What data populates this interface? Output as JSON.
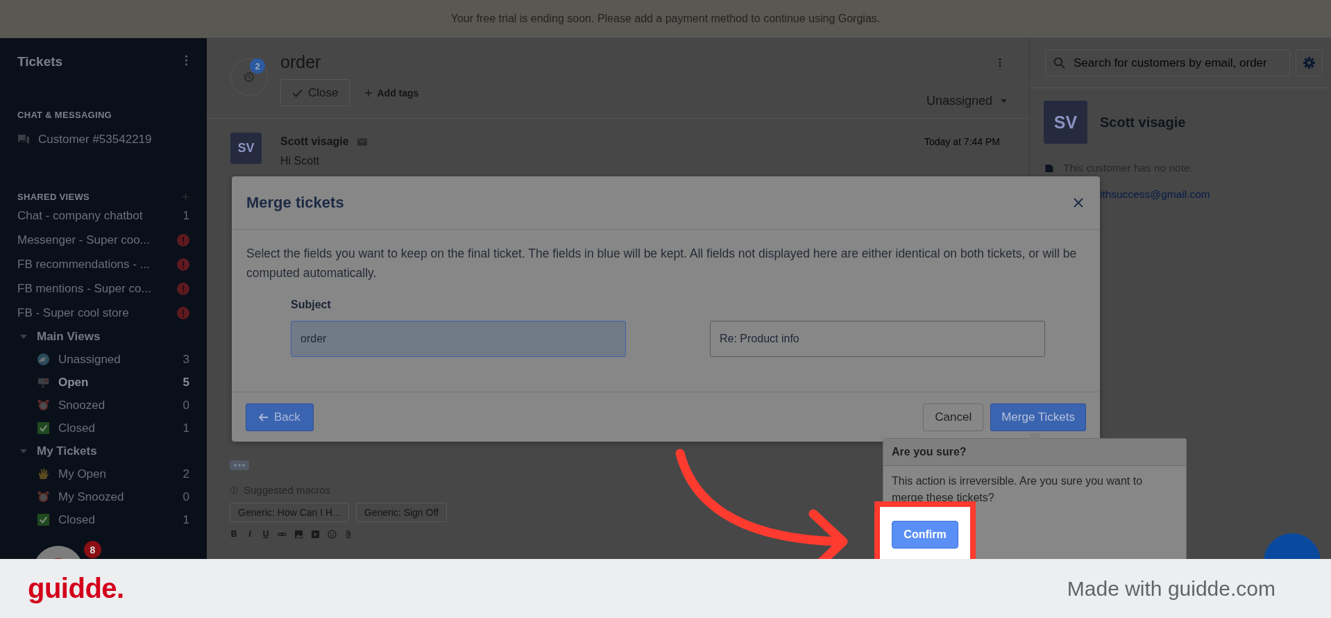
{
  "banner": {
    "text": "Your free trial is ending soon. Please add a payment method to continue using Gorgias."
  },
  "sidebar": {
    "title": "Tickets",
    "chat_section": {
      "heading": "CHAT & MESSAGING",
      "items": [
        {
          "label": "Customer #53542219"
        }
      ]
    },
    "shared_views": {
      "heading": "SHARED VIEWS",
      "items": [
        {
          "label": "Chat - company chatbot",
          "kind": "count",
          "count": "1"
        },
        {
          "label": "Messenger - Super coo...",
          "kind": "alert"
        },
        {
          "label": "FB recommendations - ...",
          "kind": "alert"
        },
        {
          "label": "FB mentions - Super co...",
          "kind": "alert"
        },
        {
          "label": "FB - Super cool store",
          "kind": "alert"
        }
      ]
    },
    "groups": [
      {
        "title": "Main Views",
        "expanded": true,
        "children": [
          {
            "label": "Unassigned",
            "kind": "wave",
            "count": "3",
            "selected": false
          },
          {
            "label": "Open",
            "kind": "mailbox",
            "count": "5",
            "selected": true
          },
          {
            "label": "Snoozed",
            "kind": "alarm",
            "count": "0",
            "selected": false
          },
          {
            "label": "Closed",
            "kind": "check",
            "count": "1",
            "selected": false
          }
        ]
      },
      {
        "title": "My Tickets",
        "expanded": true,
        "children": [
          {
            "label": "My Open",
            "kind": "hand",
            "count": "2",
            "selected": false
          },
          {
            "label": "My Snoozed",
            "kind": "alarm",
            "count": "0",
            "selected": false
          },
          {
            "label": "Closed",
            "kind": "check",
            "count": "1",
            "selected": false
          }
        ]
      }
    ],
    "account": {
      "badge": "8"
    }
  },
  "ticket": {
    "history_count": "2",
    "subject": "order",
    "close_label": "Close",
    "add_tags_label": "Add tags",
    "assignee": "Unassigned"
  },
  "message": {
    "initials": "SV",
    "author": "Scott visagie",
    "time": "Today at 7:44 PM",
    "body": "Hi Scott"
  },
  "composer": {
    "macros_label": "Suggested macros",
    "macros": [
      "Generic: How Can I H...",
      "Generic: Sign Off"
    ],
    "format_buttons": [
      "B",
      "I",
      "U"
    ]
  },
  "customer_panel": {
    "search_placeholder": "Search for customers by email, order",
    "initials": "SV",
    "name": "Scott visagie",
    "note": "This customer has no note.",
    "email": "ithsuccess@gmail.com"
  },
  "modal": {
    "title": "Merge tickets",
    "description": "Select the fields you want to keep on the final ticket. The fields in blue will be kept. All fields not displayed here are either identical on both tickets, or will be computed automatically.",
    "field_label": "Subject",
    "options": [
      {
        "value": "order",
        "selected": true
      },
      {
        "value": "Re: Product info",
        "selected": false
      }
    ],
    "back_label": "Back",
    "cancel_label": "Cancel",
    "merge_label": "Merge Tickets"
  },
  "popover": {
    "title": "Are you sure?",
    "text": "This action is irreversible. Are you sure you want to merge these tickets?",
    "confirm_label": "Confirm"
  },
  "footer": {
    "logo": "guidde.",
    "tagline": "Made with guidde.com"
  }
}
